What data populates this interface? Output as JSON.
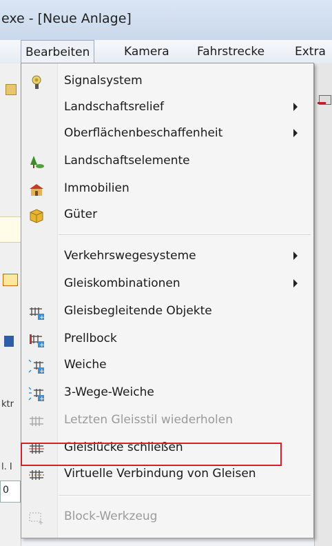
{
  "window": {
    "title": "exe - [Neue Anlage]"
  },
  "menubar": {
    "items": [
      "Bearbeiten",
      "Kamera",
      "Fahrstrecke",
      "Extra"
    ]
  },
  "left_panel": {
    "fragment_1": "ktr",
    "fragment_2": "l. I",
    "fragment_3": "0"
  },
  "dropdown": {
    "items": [
      {
        "label": "Signalsystem",
        "icon": "signal-icon",
        "submenu": false,
        "disabled": false
      },
      {
        "label": "Landschaftsrelief",
        "icon": "",
        "submenu": true,
        "disabled": false
      },
      {
        "label": "Oberflächenbeschaffenheit",
        "icon": "",
        "submenu": true,
        "disabled": false
      },
      {
        "label": "Landschaftselemente",
        "icon": "tree-icon",
        "submenu": false,
        "disabled": false
      },
      {
        "label": "Immobilien",
        "icon": "house-icon",
        "submenu": false,
        "disabled": false
      },
      {
        "label": "Güter",
        "icon": "cargo-box-icon",
        "submenu": false,
        "disabled": false
      },
      {
        "label": "Verkehrswegesysteme",
        "icon": "",
        "submenu": true,
        "disabled": false
      },
      {
        "label": "Gleiskombinationen",
        "icon": "",
        "submenu": true,
        "disabled": false
      },
      {
        "label": "Gleisbegleitende Objekte",
        "icon": "track-objects-icon",
        "submenu": false,
        "disabled": false
      },
      {
        "label": "Prellbock",
        "icon": "buffer-stop-icon",
        "submenu": false,
        "disabled": false
      },
      {
        "label": "Weiche",
        "icon": "switch-icon",
        "submenu": false,
        "disabled": false
      },
      {
        "label": "3-Wege-Weiche",
        "icon": "three-way-switch-icon",
        "submenu": false,
        "disabled": false
      },
      {
        "label": "Letzten Gleisstil wiederholen",
        "icon": "repeat-track-icon",
        "submenu": false,
        "disabled": true
      },
      {
        "label": "Gleislücke schließen",
        "icon": "close-gap-icon",
        "submenu": false,
        "disabled": false
      },
      {
        "label": "Virtuelle Verbindung von Gleisen",
        "icon": "virtual-link-icon",
        "submenu": false,
        "disabled": false
      },
      {
        "label": "Block-Werkzeug",
        "icon": "block-tool-icon",
        "submenu": false,
        "disabled": true
      }
    ]
  },
  "colors": {
    "highlight_box": "#d4202a",
    "menu_bg": "#f5f5f5"
  }
}
